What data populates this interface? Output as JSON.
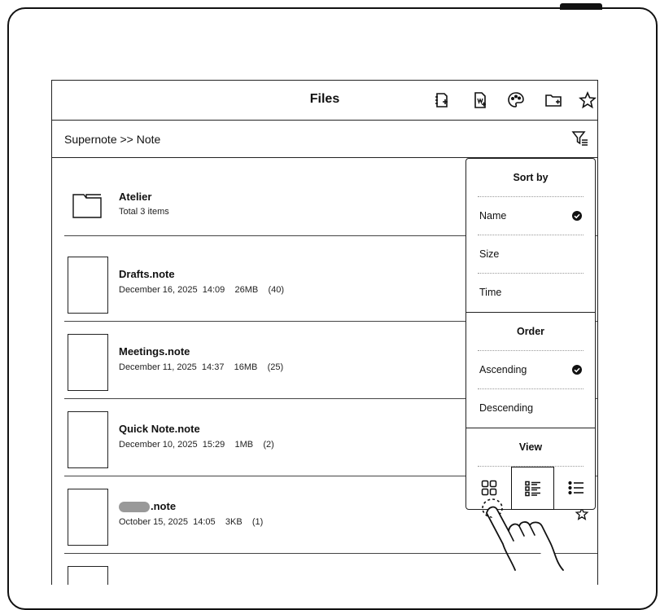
{
  "header": {
    "title": "Files",
    "icons": [
      "new-note-icon",
      "new-word-doc-icon",
      "palette-icon",
      "new-folder-icon",
      "star-icon"
    ]
  },
  "breadcrumb": {
    "path": "Supernote >> Note"
  },
  "files": [
    {
      "name": "Atelier",
      "meta": "Total 3 items",
      "type": "folder"
    },
    {
      "name": "Drafts.note",
      "meta": "December 16, 2025  14:09    26MB    (40)",
      "type": "note"
    },
    {
      "name": "Meetings.note",
      "meta": "December 11, 2025  14:37    16MB    (25)",
      "type": "note"
    },
    {
      "name": "Quick Note.note",
      "meta": "December 10, 2025  15:29    1MB    (2)",
      "type": "note"
    },
    {
      "name": ".note",
      "meta": "October 15, 2025  14:05    3KB    (1)",
      "type": "note",
      "name_redacted": true
    }
  ],
  "sort_menu": {
    "sort_by_header": "Sort by",
    "sort_options": [
      "Name",
      "Size",
      "Time"
    ],
    "sort_selected": "Name",
    "order_header": "Order",
    "order_options": [
      "Ascending",
      "Descending"
    ],
    "order_selected": "Ascending",
    "view_header": "View",
    "view_options": [
      "grid-view-icon",
      "detail-list-view-icon",
      "list-view-icon"
    ],
    "view_selected": "detail-list-view-icon"
  }
}
